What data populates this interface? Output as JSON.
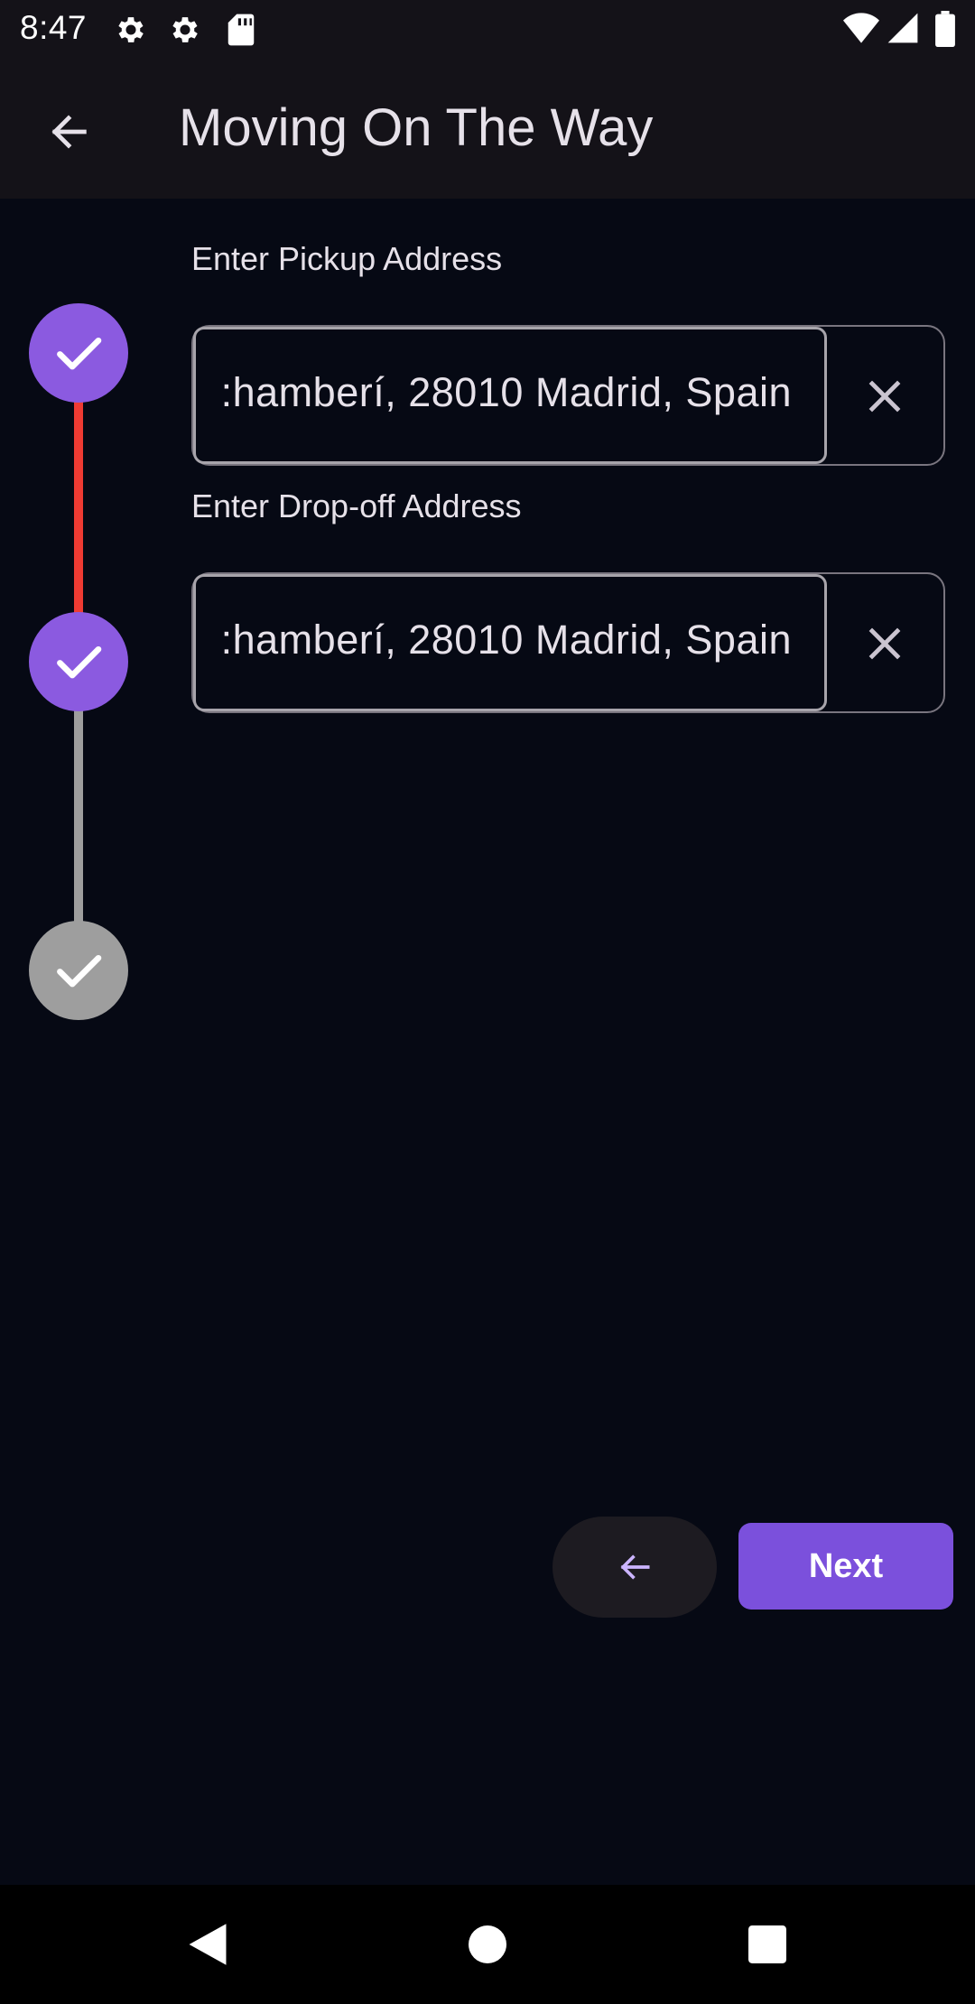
{
  "status_bar": {
    "time": "8:47",
    "icons": [
      "gear-icon",
      "gear-icon",
      "sd-card-icon",
      "wifi-icon",
      "signal-icon",
      "battery-icon"
    ]
  },
  "app_bar": {
    "back_icon": "arrow-left-icon",
    "title": "Moving On The Way"
  },
  "stepper": {
    "steps": [
      {
        "state": "completed",
        "icon": "check-icon"
      },
      {
        "state": "completed",
        "icon": "check-icon"
      },
      {
        "state": "inactive",
        "icon": "check-icon"
      }
    ],
    "colors": {
      "active_circle": "#8b5ae0",
      "inactive_circle": "#9e9e9e",
      "active_line": "#ef3b33",
      "inactive_line": "#9e9e9e"
    }
  },
  "form": {
    "pickup": {
      "label": "Enter Pickup Address",
      "value": ":hamberí, 28010 Madrid, Spain",
      "clear_icon": "close-icon"
    },
    "dropoff": {
      "label": "Enter Drop-off Address",
      "value": ":hamberí, 28010 Madrid, Spain",
      "clear_icon": "close-icon"
    }
  },
  "actions": {
    "back_icon": "arrow-left-icon",
    "next_label": "Next",
    "accent_color": "#7b50dc"
  },
  "nav_bar": {
    "icons": [
      "back-triangle-icon",
      "home-circle-icon",
      "recents-square-icon"
    ]
  }
}
